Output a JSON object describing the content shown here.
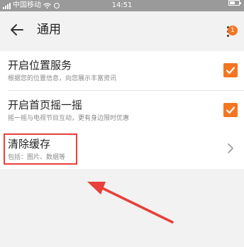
{
  "status_bar": {
    "carrier": "中国移动",
    "time": "14:51",
    "battery_level": 0.6
  },
  "header": {
    "title": "通用",
    "notification_badge": "1"
  },
  "settings": [
    {
      "title": "开启位置服务",
      "subtitle": "根据您的位置信息，向您展示丰富资讯",
      "checked": true
    },
    {
      "title": "开启首页摇一摇",
      "subtitle": "摇一摇与电视节目互动，更有身边限时优惠",
      "checked": true
    }
  ],
  "cache": {
    "title": "清除缓存",
    "subtitle": "包括：图片、数据等"
  },
  "colors": {
    "accent": "#f47621",
    "highlight": "#e8403a"
  }
}
